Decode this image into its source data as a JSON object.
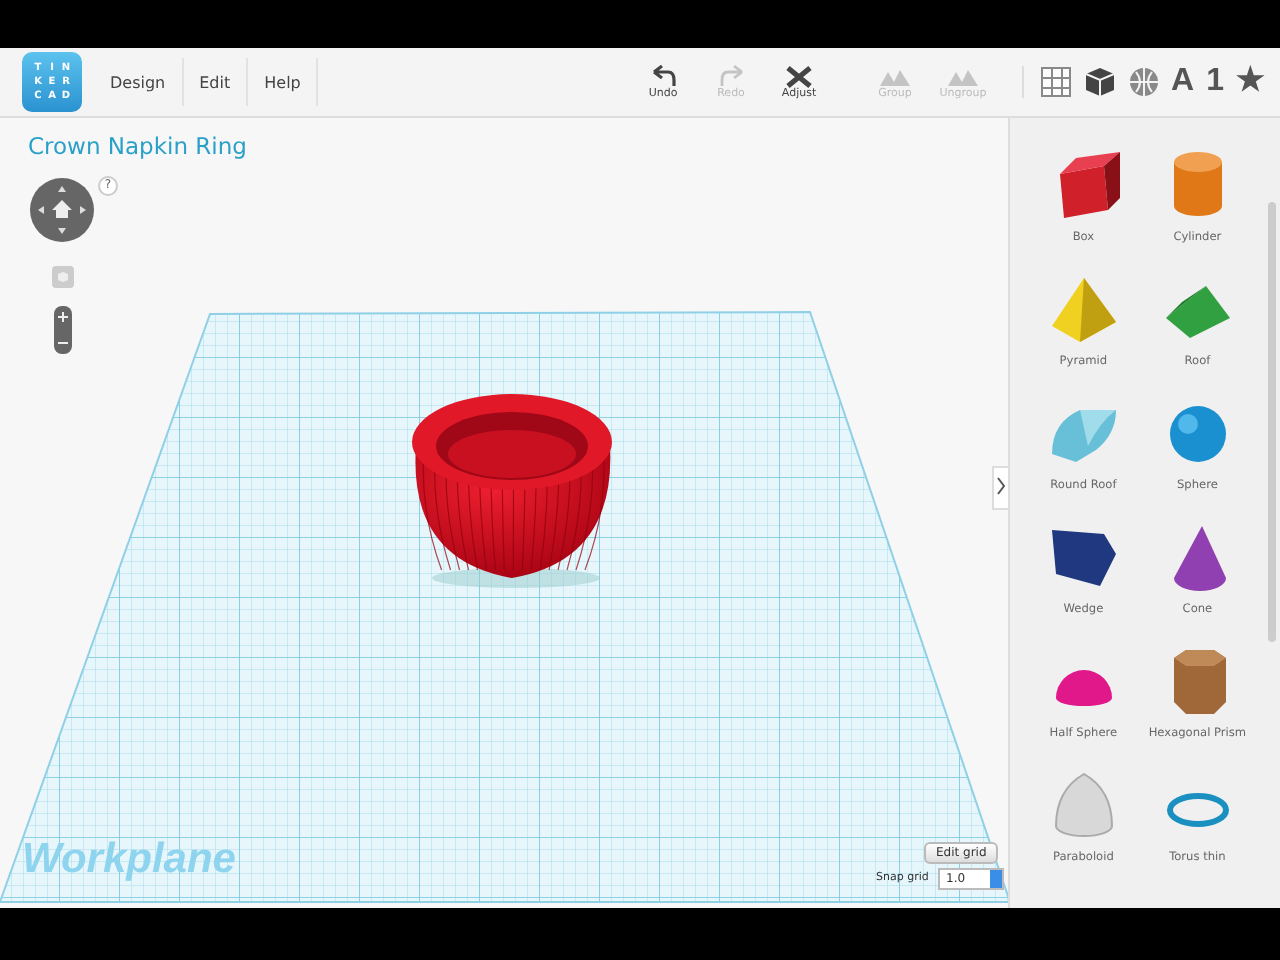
{
  "logo": {
    "letters": [
      "T",
      "I",
      "N",
      "K",
      "E",
      "R",
      "C",
      "A",
      "D"
    ]
  },
  "menu": [
    "Design",
    "Edit",
    "Help"
  ],
  "tools": [
    {
      "kind": "undo",
      "label": "Undo",
      "disabled": false
    },
    {
      "kind": "redo",
      "label": "Redo",
      "disabled": true
    },
    {
      "kind": "adjust",
      "label": "Adjust",
      "disabled": false
    },
    {
      "kind": "group",
      "label": "Group",
      "disabled": true
    },
    {
      "kind": "ungroup",
      "label": "Ungroup",
      "disabled": true
    }
  ],
  "view_tabs": [
    {
      "kind": "grid",
      "selected": false
    },
    {
      "kind": "cube",
      "selected": true
    },
    {
      "kind": "globe",
      "selected": false
    },
    {
      "kind": "text",
      "label": "A",
      "selected": false
    },
    {
      "kind": "text",
      "label": "1",
      "selected": false
    },
    {
      "kind": "text",
      "label": "★",
      "selected": false
    }
  ],
  "design_title": "Crown Napkin Ring",
  "help": "?",
  "workplane": {
    "label": "Workplane",
    "edit_grid": "Edit grid",
    "snap_label": "Snap grid",
    "snap_value": "1.0"
  },
  "shapes": [
    {
      "kind": "box",
      "label": "Box",
      "color": "#d0202a"
    },
    {
      "kind": "cylinder",
      "label": "Cylinder",
      "color": "#e07818"
    },
    {
      "kind": "pyramid",
      "label": "Pyramid",
      "color": "#f0d020"
    },
    {
      "kind": "roof",
      "label": "Roof",
      "color": "#30a040"
    },
    {
      "kind": "roundroof",
      "label": "Round Roof",
      "color": "#68c0d8"
    },
    {
      "kind": "sphere",
      "label": "Sphere",
      "color": "#1a90d0"
    },
    {
      "kind": "wedge",
      "label": "Wedge",
      "color": "#203880"
    },
    {
      "kind": "cone",
      "label": "Cone",
      "color": "#9040b0"
    },
    {
      "kind": "halfsphere",
      "label": "Half Sphere",
      "color": "#e0188a"
    },
    {
      "kind": "hexprism",
      "label": "Hexagonal Prism",
      "color": "#a06838"
    },
    {
      "kind": "paraboloid",
      "label": "Paraboloid",
      "color": "#d8d8d8"
    },
    {
      "kind": "torus",
      "label": "Torus thin",
      "color": "#1a90c0"
    }
  ]
}
